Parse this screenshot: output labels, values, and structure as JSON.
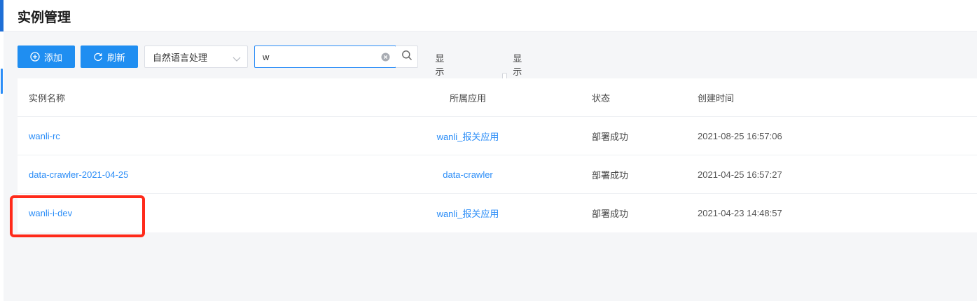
{
  "page": {
    "title": "实例管理"
  },
  "toolbar": {
    "add_label": "添加",
    "refresh_label": "刷新",
    "category_select": {
      "selected": "自然语言处理"
    },
    "search": {
      "value": "w"
    },
    "checkbox_stopped": "显示已停止",
    "checkbox_mine": "显示我的"
  },
  "table": {
    "headers": {
      "name": "实例名称",
      "app": "所属应用",
      "status": "状态",
      "created": "创建时间"
    },
    "rows": [
      {
        "name": "wanli-rc",
        "app": "wanli_报关应用",
        "status": "部署成功",
        "created": "2021-08-25 16:57:06"
      },
      {
        "name": "data-crawler-2021-04-25",
        "app": "data-crawler",
        "status": "部署成功",
        "created": "2021-04-25 16:57:27"
      },
      {
        "name": "wanli-i-dev",
        "app": "wanli_报关应用",
        "status": "部署成功",
        "created": "2021-04-23 14:48:57"
      }
    ]
  },
  "colors": {
    "primary": "#1f8ef1",
    "link": "#2b8df7",
    "highlight": "#ff2a1a",
    "accent": "#1f6fd6"
  },
  "icons": {
    "add": "plus-circle-icon",
    "refresh": "refresh-icon",
    "dropdown": "chevron-down-icon",
    "clear": "clear-circle-icon",
    "search": "search-icon"
  }
}
